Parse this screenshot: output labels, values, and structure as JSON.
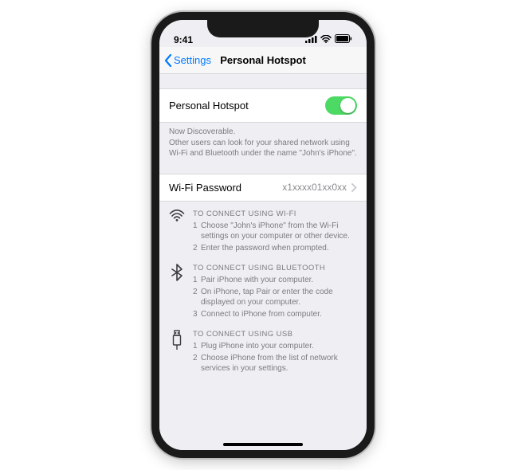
{
  "status": {
    "time": "9:41"
  },
  "nav": {
    "back": "Settings",
    "title": "Personal Hotspot"
  },
  "toggle": {
    "label": "Personal Hotspot",
    "on": true
  },
  "discoverable": {
    "line1": "Now Discoverable.",
    "line2": "Other users can look for your shared network using Wi-Fi and Bluetooth under the name \"John's iPhone\"."
  },
  "password": {
    "label": "Wi-Fi Password",
    "value": "x1xxxx01xx0xx"
  },
  "wifi": {
    "header": "TO CONNECT USING WI-FI",
    "s1": "Choose \"John's iPhone\" from the Wi-Fi settings on your computer or other device.",
    "s2": "Enter the password when prompted."
  },
  "bt": {
    "header": "TO CONNECT USING BLUETOOTH",
    "s1": "Pair iPhone with your computer.",
    "s2": "On iPhone, tap Pair or enter the code displayed on your computer.",
    "s3": "Connect to iPhone from computer."
  },
  "usb": {
    "header": "TO CONNECT USING USB",
    "s1": "Plug iPhone into your computer.",
    "s2": "Choose iPhone from the list of network services in your settings."
  }
}
